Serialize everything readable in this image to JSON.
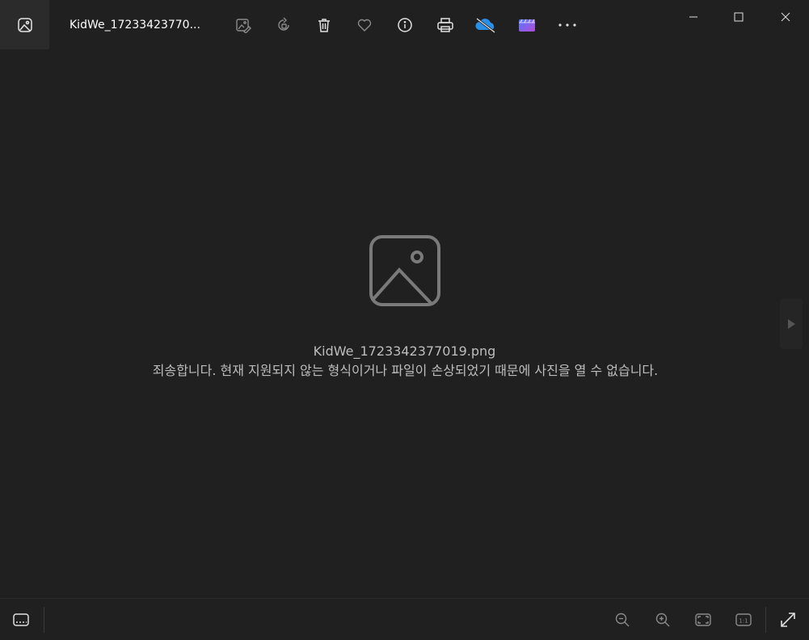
{
  "titlebar": {
    "filename": "KidWe_17233423770...",
    "icons": [
      "photos-app-icon",
      "edit-image-icon",
      "rotate-icon",
      "delete-icon",
      "favorite-icon",
      "info-icon",
      "print-icon",
      "onedrive-icon",
      "clipchamp-icon",
      "more-icon"
    ],
    "window_controls": [
      "minimize-icon",
      "maximize-icon",
      "close-icon"
    ]
  },
  "main": {
    "error_filename": "KidWe_1723342377019.png",
    "error_message": "죄송합니다. 현재 지원되지 않는 형식이거나 파일이 손상되었기 때문에 사진을 열 수 없습니다."
  },
  "bottombar": {
    "icons": [
      "filmstrip-icon",
      "zoom-out-icon",
      "zoom-in-icon",
      "fit-to-window-icon",
      "actual-size-icon",
      "fullscreen-icon"
    ],
    "actual_size_label": "1:1"
  },
  "colors": {
    "background": "#202020",
    "text": "#bdbdbd",
    "title_text": "#ffffff",
    "icon": "#d0d0d0"
  }
}
